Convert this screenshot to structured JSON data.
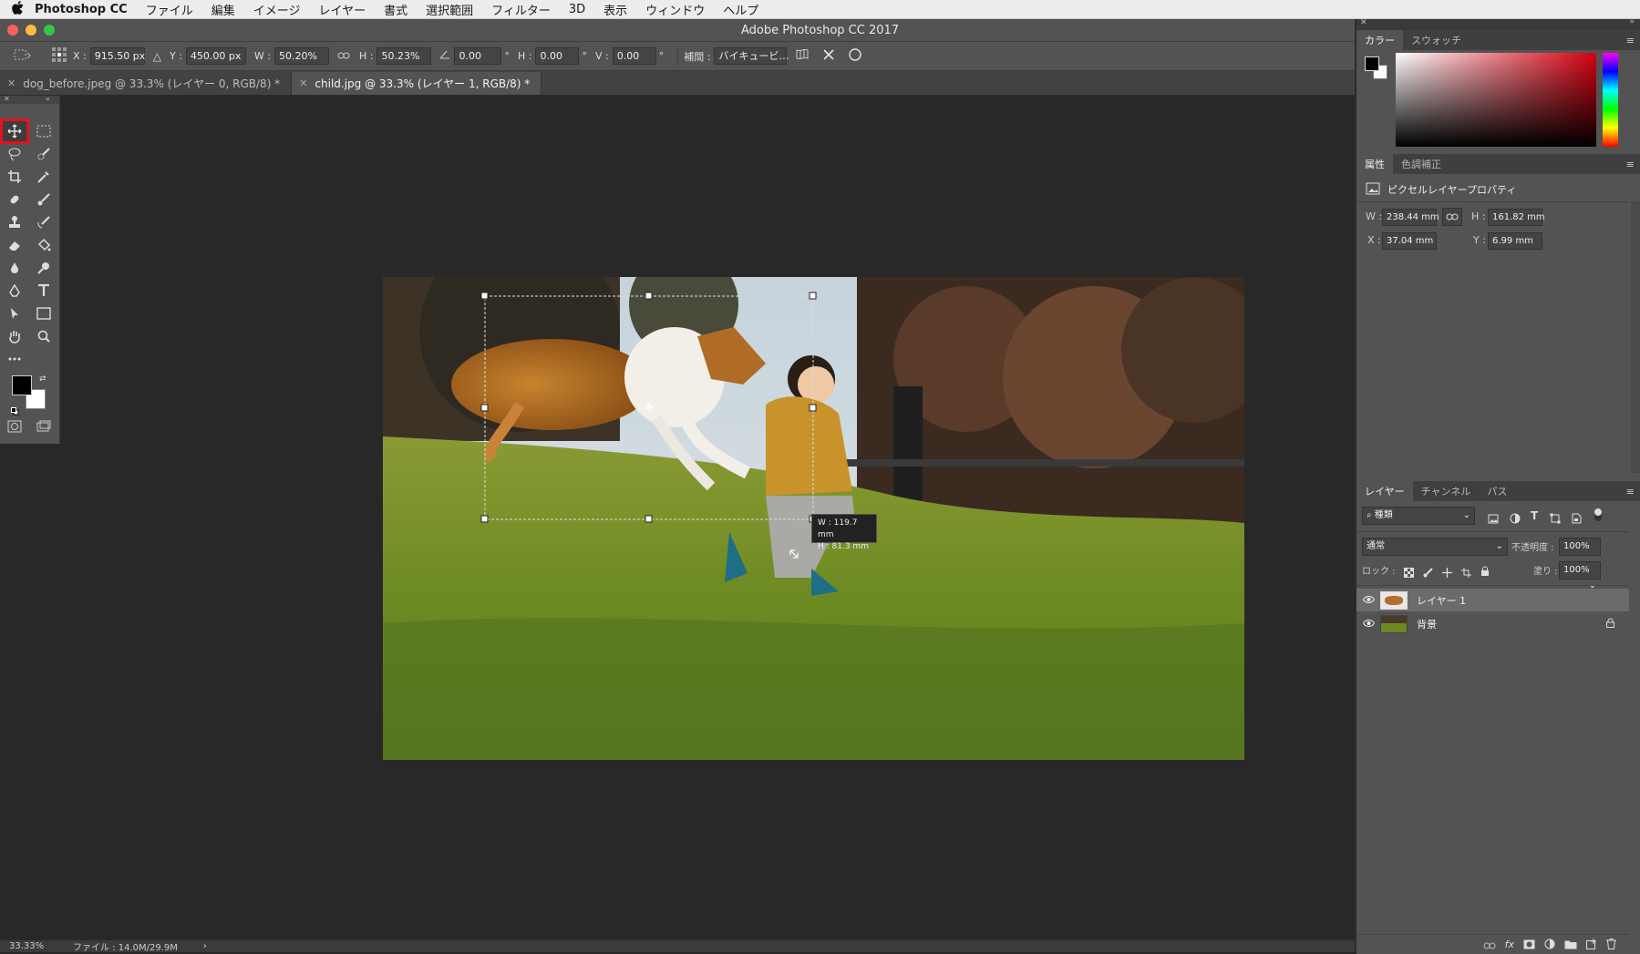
{
  "menubar": {
    "apple": "",
    "app": "Photoshop CC",
    "items": [
      "ファイル",
      "編集",
      "イメージ",
      "レイヤー",
      "書式",
      "選択範囲",
      "フィルター",
      "3D",
      "表示",
      "ウィンドウ",
      "ヘルプ"
    ]
  },
  "window": {
    "title": "Adobe Photoshop CC 2017"
  },
  "options": {
    "x_label": "X :",
    "x": "915.50 px",
    "y_label": "Y :",
    "y": "450.00 px",
    "w_label": "W :",
    "w": "50.20%",
    "h_label": "H :",
    "h": "50.23%",
    "angle": "0.00",
    "deg": "°",
    "hskew_label": "H :",
    "hskew": "0.00",
    "vskew_label": "V :",
    "vskew": "0.00",
    "interp_label": "補間 :",
    "interp": "バイキュービ…"
  },
  "doc_tabs": [
    {
      "label": "dog_before.jpeg @ 33.3% (レイヤー 0, RGB/8) *",
      "active": false
    },
    {
      "label": "child.jpg @ 33.3% (レイヤー 1, RGB/8) *",
      "active": true
    }
  ],
  "transform_tooltip": {
    "w": "W : 119.7 mm",
    "h": "H :   81.3 mm"
  },
  "status": {
    "zoom": "33.33%",
    "file": "ファイル : 14.0M/29.9M",
    "arrow": "›"
  },
  "color_panel": {
    "tabs": [
      "カラー",
      "スウォッチ"
    ],
    "fg": "#000000",
    "bg": "#ffffff",
    "hue_color": "#d40010"
  },
  "properties_panel": {
    "tabs": [
      "属性",
      "色調補正"
    ],
    "title": "ピクセルレイヤープロパティ",
    "w_label": "W :",
    "w": "238.44 mm",
    "h_label": "H :",
    "h": "161.82 mm",
    "x_label": "X :",
    "x": "37.04 mm",
    "y_label": "Y :",
    "y": "6.99 mm"
  },
  "layers_panel": {
    "tabs": [
      "レイヤー",
      "チャンネル",
      "パス"
    ],
    "filter": "種類",
    "blend": "通常",
    "opacity_label": "不透明度 :",
    "opacity": "100%",
    "lock_label": "ロック :",
    "fill_label": "塗り :",
    "fill": "100%",
    "layers": [
      {
        "name": "レイヤー 1",
        "selected": true,
        "locked": false
      },
      {
        "name": "背景",
        "selected": false,
        "locked": true
      }
    ]
  }
}
